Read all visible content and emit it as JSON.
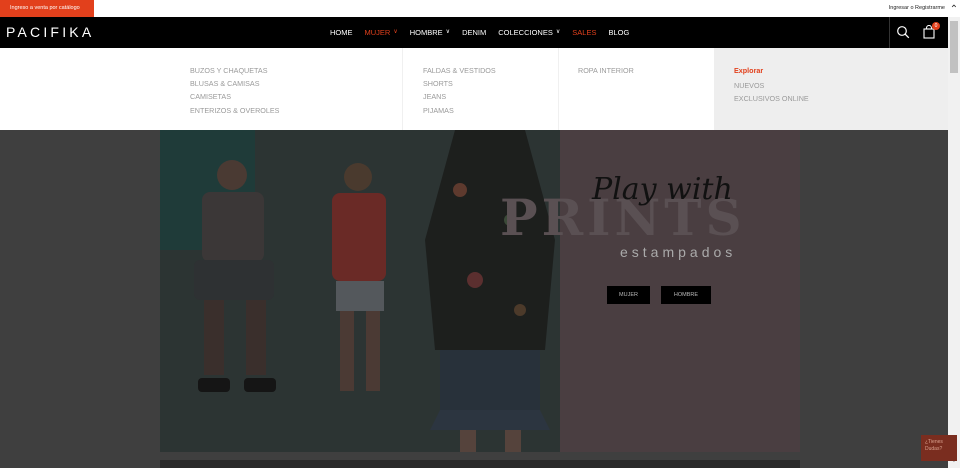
{
  "topbar": {
    "catalog_label": "Ingreso a venta por catálogo",
    "login_label": "Ingresar o Registrarme"
  },
  "brand": {
    "logo": "PACIFIKA",
    "accent_color": "#e2401c"
  },
  "nav": {
    "items": [
      {
        "label": "HOME",
        "caret": false,
        "state": "normal"
      },
      {
        "label": "MUJER",
        "caret": true,
        "state": "active"
      },
      {
        "label": "HOMBRE",
        "caret": true,
        "state": "normal"
      },
      {
        "label": "DENIM",
        "caret": false,
        "state": "normal"
      },
      {
        "label": "COLECCIONES",
        "caret": true,
        "state": "normal"
      },
      {
        "label": "SALES",
        "caret": false,
        "state": "highlight"
      },
      {
        "label": "BLOG",
        "caret": false,
        "state": "normal"
      }
    ],
    "icons": {
      "search": "search-icon",
      "cart": "shopping-bag-icon"
    },
    "cart_count": "0"
  },
  "mega_menu": {
    "column_1": [
      "BUZOS Y CHAQUETAS",
      "BLUSAS & CAMISAS",
      "CAMISETAS",
      "ENTERIZOS & OVEROLES"
    ],
    "column_2": [
      "FALDAS & VESTIDOS",
      "SHORTS",
      "JEANS",
      "PIJAMAS"
    ],
    "column_3": [
      "ROPA INTERIOR"
    ],
    "explore": {
      "title": "Explorar",
      "links": [
        "NUEVOS",
        "EXCLUSIVOS ONLINE"
      ]
    }
  },
  "hero": {
    "headline": "Play with",
    "background_word": "PRINTS",
    "subtitle": "estampados",
    "buttons": [
      "MUJER",
      "HOMBRE"
    ]
  },
  "chat": {
    "label": "¿Tienes Dudas?"
  }
}
